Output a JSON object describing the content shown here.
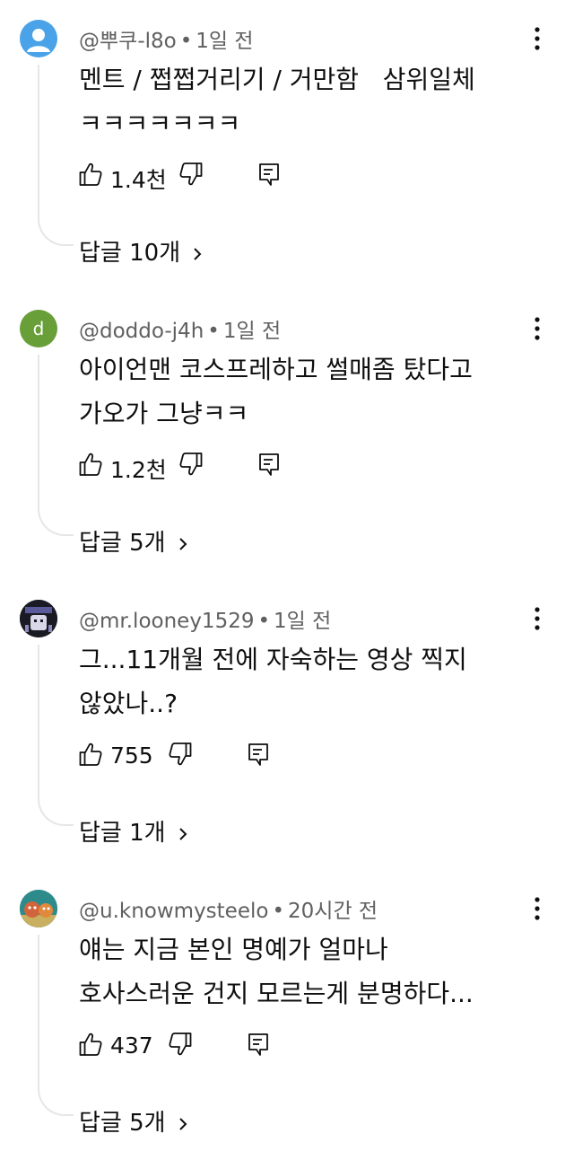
{
  "comments": [
    {
      "author": "@뿌쿠-l8o",
      "time": "1일 전",
      "line1": "멘트 / 쩝쩝거리기 / 거만함   삼위일체",
      "line2": "ㅋㅋㅋㅋㅋㅋㅋ",
      "likes": "1.4천",
      "replies": "답글 10개",
      "avatar_letter": "",
      "avatar_color": "#4aa3e8"
    },
    {
      "author": "@doddo-j4h",
      "time": "1일 전",
      "line1": "아이언맨 코스프레하고 썰매좀 탔다고",
      "line2": "가오가 그냥ㅋㅋ",
      "likes": "1.2천",
      "replies": "답글 5개",
      "avatar_letter": "d",
      "avatar_color": "#689f38"
    },
    {
      "author": "@mr.looney1529",
      "time": "1일 전",
      "line1": "그...11개월 전에 자숙하는 영상 찍지",
      "line2": "않았나..?",
      "likes": "755",
      "replies": "답글 1개",
      "avatar_letter": "",
      "avatar_color": "#1a1a24"
    },
    {
      "author": "@u.knowmysteelo",
      "time": "20시간 전",
      "line1": "얘는 지금 본인 명예가 얼마나",
      "line2": "호사스러운 건지 모르는게 분명하다...",
      "likes": "437",
      "replies": "답글 5개",
      "avatar_letter": "",
      "avatar_color": "#2e8b8b"
    }
  ],
  "icons": {
    "like": "thumbs-up-icon",
    "dislike": "thumbs-down-icon",
    "reply": "reply-icon",
    "more": "more-vertical-icon",
    "chevron": "chevron-right-icon"
  },
  "colors": {
    "text": "#0f0f0f",
    "meta": "#606060",
    "thread_line": "#e6e6e6"
  }
}
